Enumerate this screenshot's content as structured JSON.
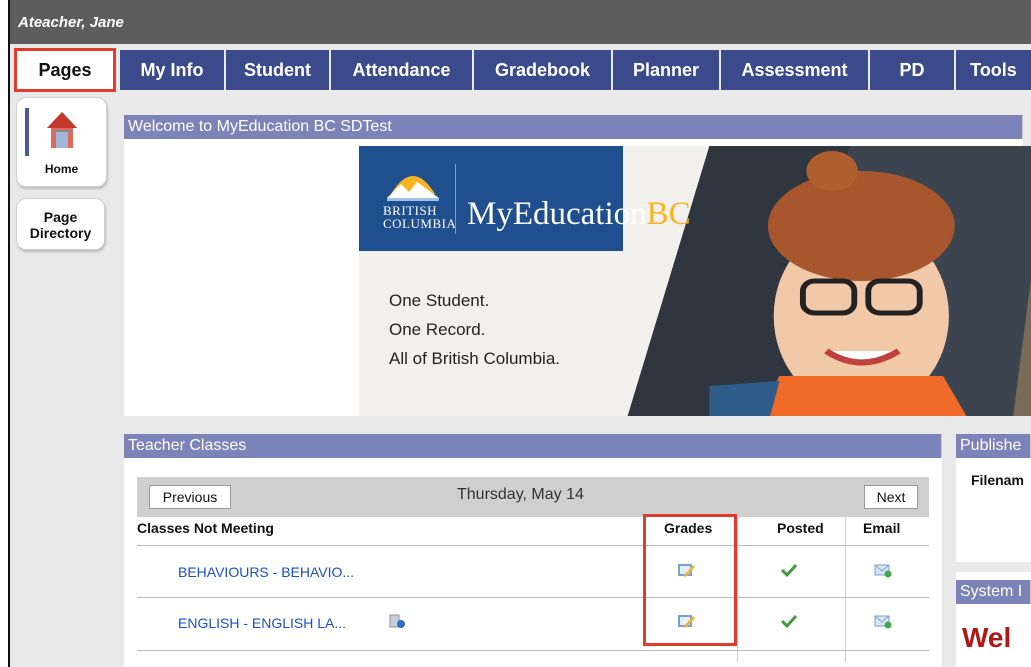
{
  "header": {
    "user_name": "Ateacher, Jane"
  },
  "nav": {
    "pages": "Pages",
    "tabs": [
      "My Info",
      "Student",
      "Attendance",
      "Gradebook",
      "Planner",
      "Assessment",
      "PD",
      "Tools"
    ]
  },
  "sidebar": {
    "home": "Home",
    "page_directory": "Page Directory"
  },
  "welcome": {
    "title": "Welcome to MyEducation BC SDTest",
    "banner_province": "BRITISH\nCOLUMBIA",
    "banner_brand_a": "MyEducation",
    "banner_brand_b": "BC",
    "tagline": [
      "One Student.",
      "One Record.",
      "All of British Columbia."
    ]
  },
  "teacher_classes": {
    "title": "Teacher Classes",
    "prev": "Previous",
    "next": "Next",
    "date": "Thursday, May 14",
    "columns": {
      "name": "Classes Not Meeting",
      "grades": "Grades",
      "posted": "Posted",
      "email": "Email"
    },
    "rows": [
      {
        "name": "BEHAVIOURS - BEHAVIO..."
      },
      {
        "name": "ENGLISH - ENGLISH LA..."
      }
    ]
  },
  "right_panels": {
    "published": "Publishe",
    "filename": "Filenam",
    "system": "System I",
    "welcome_partial": "Wel"
  },
  "colors": {
    "tab_bg": "#3b4a8a",
    "header_bg": "#7b83b9",
    "highlight": "#e23a2b",
    "link": "#1a4fc8"
  }
}
